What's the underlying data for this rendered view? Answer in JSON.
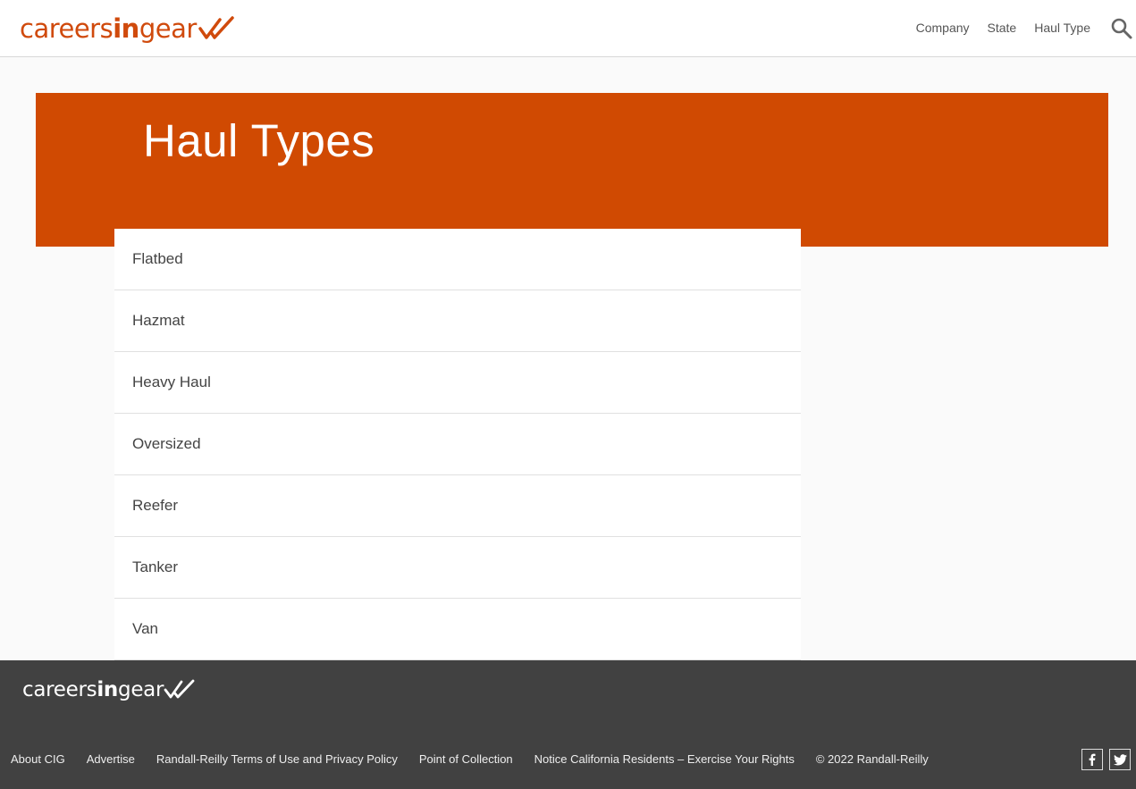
{
  "header": {
    "logo": {
      "part1": "careers",
      "part2": "in",
      "part3": "gear"
    },
    "nav": [
      "Company",
      "State",
      "Haul Type"
    ]
  },
  "hero": {
    "title": "Haul Types"
  },
  "haul_types": [
    "Flatbed",
    "Hazmat",
    "Heavy Haul",
    "Oversized",
    "Reefer",
    "Tanker",
    "Van"
  ],
  "footer": {
    "logo": {
      "part1": "careers",
      "part2": "in",
      "part3": "gear"
    },
    "links": [
      "About CIG",
      "Advertise",
      "Randall-Reilly Terms of Use and Privacy Policy",
      "Point of Collection",
      "Notice California Residents – Exercise Your Rights"
    ],
    "copyright": "© 2022 Randall-Reilly"
  },
  "colors": {
    "brand": "#d04a02",
    "footer_bg": "#414141"
  },
  "icons": {
    "search": "search-icon",
    "facebook": "facebook-icon",
    "twitter": "twitter-icon",
    "logo_mark": "double-check-icon"
  }
}
